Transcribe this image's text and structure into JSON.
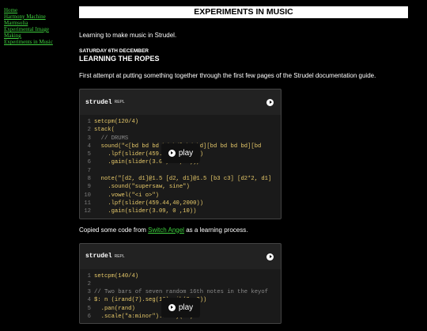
{
  "nav": {
    "links": [
      "Home",
      "Harmony Machine",
      "Marmsolia",
      "Experimental Image",
      "Making",
      "Experiments in Music"
    ]
  },
  "page": {
    "title": "EXPERIMENTS IN MUSIC",
    "intro": "Learning to make music in Strudel.",
    "post_date": "SATURDAY 6TH DECEMBER",
    "post_title": "LEARNING THE ROPES",
    "para1": "First attempt at putting something together through the first few pages of the Strudel documentation guide.",
    "para2_before": "Copied some code from ",
    "para2_link": "Switch Angel",
    "para2_after": " as a learning process."
  },
  "repl1": {
    "title": "strudel",
    "tag": "REPL",
    "play_label": "play",
    "lines": [
      {
        "n": "1",
        "t": "setcpm(120/4)"
      },
      {
        "n": "2",
        "t": "stack("
      },
      {
        "n": "3",
        "t": "  // DRUMS"
      },
      {
        "n": "4",
        "t": "  sound(\"<[bd bd bd bd bd] bd bd][bd bd bd bd][bd"
      },
      {
        "n": "5",
        "t": "    .lpf(slider(459.44,40,2000))"
      },
      {
        "n": "6",
        "t": "    .gain(slider(3.09, 0 ,10)),"
      },
      {
        "n": "7",
        "t": ""
      },
      {
        "n": "8",
        "t": "  note(\"[d2, d1]@1.5 [d2, d1]@1.5 [b3 c3] [d2*2, d1]"
      },
      {
        "n": "9",
        "t": "    .sound(\"supersaw, sine\")"
      },
      {
        "n": "10",
        "t": "    .vowel(\"<i o>\")"
      },
      {
        "n": "11",
        "t": "    .lpf(slider(459.44,40,2000))"
      },
      {
        "n": "12",
        "t": "    .gain(slider(3.09, 0 ,10))"
      }
    ]
  },
  "repl2": {
    "title": "strudel",
    "tag": "REPL",
    "play_label": "play",
    "lines": [
      {
        "n": "1",
        "t": "setcpm(140/4)"
      },
      {
        "n": "2",
        "t": ""
      },
      {
        "n": "3",
        "t": "// Two bars of seven random 16th notes in the keyof"
      },
      {
        "n": "4",
        "t": "$: n (irand(7).seg(16).rib(0, 2))"
      },
      {
        "n": "5",
        "t": "  .pan(rand)"
      },
      {
        "n": "6",
        "t": "  .scale(\"a:minor\").delay(.6)"
      }
    ]
  }
}
